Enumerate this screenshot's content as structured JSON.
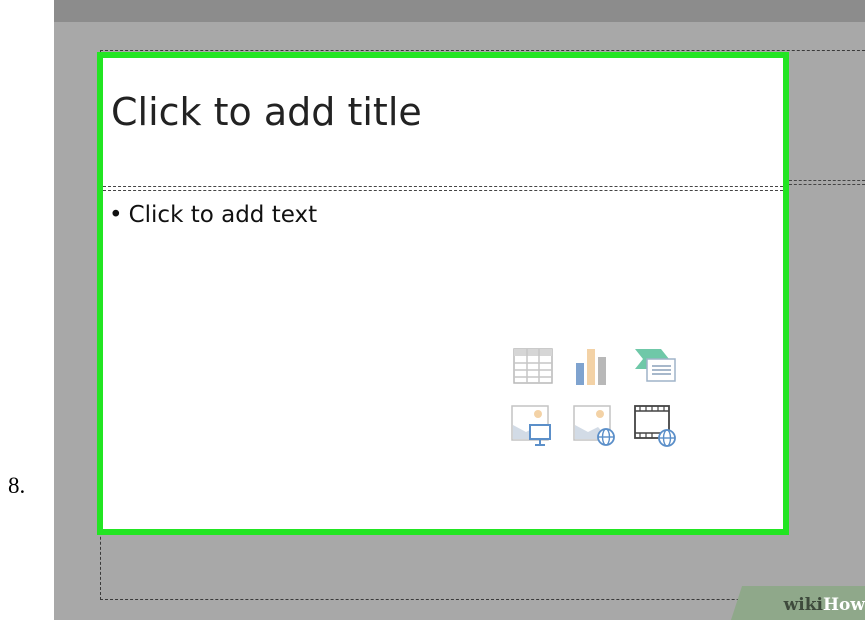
{
  "step": {
    "number": "8."
  },
  "slide": {
    "title_placeholder": "Click to add title",
    "body_bullet": "•",
    "body_placeholder": "Click to add text"
  },
  "content_icons": [
    {
      "icon": "table-icon"
    },
    {
      "icon": "chart-icon"
    },
    {
      "icon": "smartart-icon"
    },
    {
      "icon": "pictures-icon"
    },
    {
      "icon": "online-pictures-icon"
    },
    {
      "icon": "video-icon"
    }
  ],
  "watermark": {
    "part1": "wiki",
    "part2": "How"
  },
  "colors": {
    "canvas": "#a8a8a8",
    "selection_border": "#22e522",
    "slide": "#ffffff"
  }
}
